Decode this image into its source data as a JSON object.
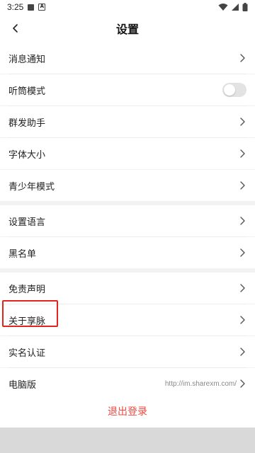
{
  "status_bar": {
    "time": "3:25"
  },
  "header": {
    "title": "设置"
  },
  "items": [
    {
      "label": "消息通知"
    },
    {
      "label": "听筒模式",
      "toggle_on": false
    },
    {
      "label": "群发助手"
    },
    {
      "label": "字体大小"
    },
    {
      "label": "青少年模式"
    },
    {
      "label": "设置语言"
    },
    {
      "label": "黑名单"
    },
    {
      "label": "免责声明"
    },
    {
      "label": "关于享脉"
    },
    {
      "label": "实名认证"
    },
    {
      "label": "电脑版",
      "value": "http://im.sharexm.com/"
    }
  ],
  "logout_label": "退出登录",
  "colors": {
    "accent": "#f0473e",
    "highlight": "#e0251f",
    "background": "#f2f2f2"
  }
}
